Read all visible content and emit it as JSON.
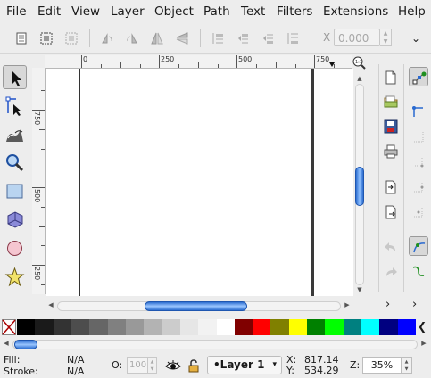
{
  "menubar": {
    "items": [
      "File",
      "Edit",
      "View",
      "Layer",
      "Object",
      "Path",
      "Text",
      "Filters",
      "Extensions",
      "Help"
    ]
  },
  "toolbar": {
    "x_label": "X",
    "x_value": "0.000",
    "icons": [
      "select-all-icon",
      "select-all-layers-icon",
      "deselect-icon",
      "rotate-ccw-icon",
      "rotate-cw-icon",
      "flip-horizontal-icon",
      "flip-vertical-icon",
      "raise-to-top-icon",
      "raise-icon",
      "lower-icon",
      "lower-to-bottom-icon"
    ]
  },
  "toolbox": {
    "tools": [
      {
        "name": "selector-tool",
        "icon": "arrow-icon",
        "active": true
      },
      {
        "name": "node-tool",
        "icon": "node-icon",
        "active": false
      },
      {
        "name": "tweak-tool",
        "icon": "tweak-icon",
        "active": false
      },
      {
        "name": "zoom-tool",
        "icon": "magnifier-icon",
        "active": false
      },
      {
        "name": "rectangle-tool",
        "icon": "rectangle-icon",
        "active": false
      },
      {
        "name": "3d-box-tool",
        "icon": "box-icon",
        "active": false
      },
      {
        "name": "circle-tool",
        "icon": "circle-icon",
        "active": false
      },
      {
        "name": "star-tool",
        "icon": "star-icon",
        "active": false
      }
    ]
  },
  "rulers": {
    "horizontal": [
      "0",
      "250",
      "500",
      "750"
    ],
    "vertical": [
      "750",
      "500",
      "250"
    ]
  },
  "palette": {
    "colors": [
      "#000000",
      "#1a1a1a",
      "#333333",
      "#4d4d4d",
      "#666666",
      "#808080",
      "#999999",
      "#b3b3b3",
      "#cccccc",
      "#e6e6e6",
      "#f2f2f2",
      "#ffffff",
      "#800000",
      "#ff0000",
      "#808000",
      "#ffff00",
      "#008000",
      "#00ff00",
      "#008080",
      "#00ffff",
      "#000080",
      "#0000ff"
    ]
  },
  "status": {
    "fill_label": "Fill:",
    "fill_value": "N/A",
    "stroke_label": "Stroke:",
    "stroke_value": "N/A",
    "opacity_label": "O:",
    "opacity_value": "100",
    "layer_name": "•Layer 1",
    "x_label": "X:",
    "x_value": "817.14",
    "y_label": "Y:",
    "y_value": "534.29",
    "zoom_label": "Z:",
    "zoom_value": "35%"
  }
}
